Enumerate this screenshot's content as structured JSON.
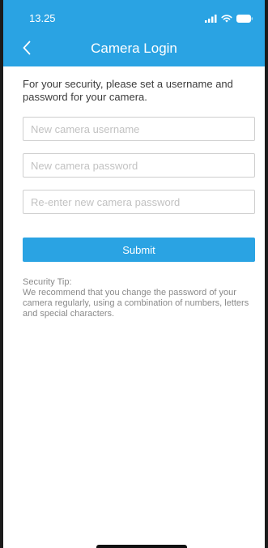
{
  "status_bar": {
    "time": "13.25",
    "icons": [
      "cellular-signal-icon",
      "wifi-icon",
      "battery-icon"
    ]
  },
  "nav": {
    "back_icon": "chevron-left-icon",
    "title": "Camera Login"
  },
  "form": {
    "intro": "For your security, please set a username and password for your camera.",
    "username_placeholder": "New camera username",
    "password_placeholder": "New camera password",
    "confirm_placeholder": "Re-enter new camera password",
    "submit_label": "Submit"
  },
  "tip": {
    "heading": "Security Tip:",
    "body": "We recommend that you change the password of your camera regularly, using a combination of numbers, letters and special characters."
  },
  "colors": {
    "accent": "#2aa3e3",
    "border": "#cfcfcf",
    "placeholder": "#c2c2c2",
    "tip_text": "#8a8a8a"
  }
}
